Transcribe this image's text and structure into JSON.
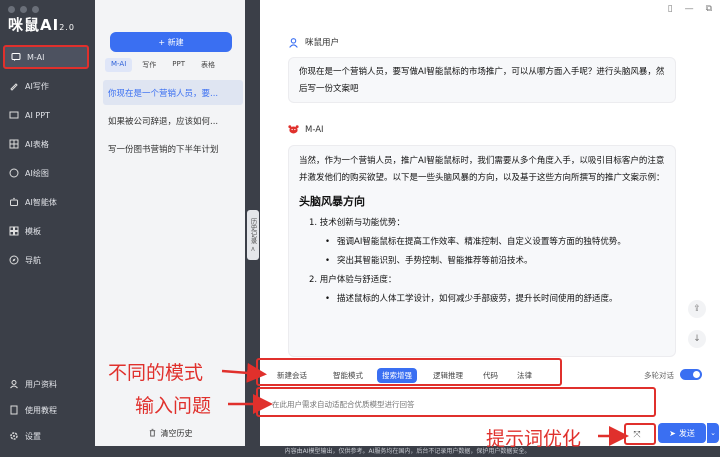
{
  "app": {
    "logo": "咪鼠AI",
    "logo_version": "2.0"
  },
  "sidebar": {
    "items": [
      {
        "label": "M-AI",
        "icon": "chat-icon"
      },
      {
        "label": "AI写作",
        "icon": "pen-icon"
      },
      {
        "label": "AI PPT",
        "icon": "ppt-icon"
      },
      {
        "label": "AI表格",
        "icon": "table-icon"
      },
      {
        "label": "AI绘图",
        "icon": "palette-icon"
      },
      {
        "label": "AI智能体",
        "icon": "bot-icon"
      },
      {
        "label": "模板",
        "icon": "template-icon"
      },
      {
        "label": "导航",
        "icon": "compass-icon"
      }
    ],
    "bottom": [
      {
        "label": "用户资料",
        "icon": "user-icon"
      },
      {
        "label": "使用教程",
        "icon": "book-icon"
      },
      {
        "label": "设置",
        "icon": "gear-icon"
      }
    ]
  },
  "history": {
    "new_label": "+ 新建",
    "tabs": [
      "M-AI",
      "写作",
      "PPT",
      "表格"
    ],
    "items": [
      "你现在是一个营销人员，要...",
      "如果被公司辞退，应该如何...",
      "写一份图书营销的下半年计划"
    ],
    "clear_label": "清空历史",
    "collapse_label": "历史记录 <"
  },
  "chat": {
    "user_name": "咪鼠用户",
    "user_message": "你现在是一个营销人员，要写做AI智能鼠标的市场推广，可以从哪方面入手呢？进行头脑风暴，然后写一份文案吧",
    "ai_name": "M-AI",
    "ai_intro": "当然，作为一个营销人员，推广AI智能鼠标时，我们需要从多个角度入手，以吸引目标客户的注意并激发他们的购买欲望。以下是一些头脑风暴的方向，以及基于这些方向所撰写的推广文案示例：",
    "ai_heading": "头脑风暴方向",
    "ai_point1": "1. 技术创新与功能优势：",
    "ai_point1_bullets": [
      "强调AI智能鼠标在提高工作效率、精准控制、自定义设置等方面的独特优势。",
      "突出其智能识别、手势控制、智能推荐等前沿技术。"
    ],
    "ai_point2": "2. 用户体验与舒适度：",
    "ai_point2_bullets": [
      "描述鼠标的人体工学设计，如何减少手部疲劳，提升长时间使用的舒适度。"
    ]
  },
  "modes": {
    "items": [
      "新建会话",
      "智能模式",
      "搜索增强",
      "逻辑推理",
      "代码",
      "法律"
    ],
    "active_index": 2,
    "multi_label": "多轮对话",
    "multi_on": true
  },
  "input": {
    "placeholder": "在此用户需求自动适配合优质模型进行回答"
  },
  "send_label": "发送",
  "footer": "内容由AI模型输出，仅供参考。AI服务均在国内，后台不记录用户数据，保护用户数据安全。",
  "annotations": {
    "modes": "不同的模式",
    "input": "输入问题",
    "optimize": "提示词优化"
  },
  "colors": {
    "accent": "#3a6ff2",
    "annotation": "#e0302c",
    "sidebar_bg": "#3b3f48"
  }
}
